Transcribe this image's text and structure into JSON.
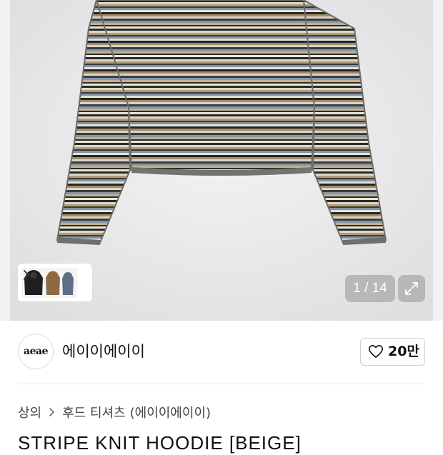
{
  "gallery": {
    "counter": "1 / 14",
    "colors": {
      "background": "#e9e9eb",
      "stripe_dark": "#2b2a26",
      "stripe_tan": "#b39b73",
      "stripe_blue": "#7f93ab",
      "stripe_cream": "#ddd8ca"
    }
  },
  "brand": {
    "logo_text": "aeae",
    "name": "에이이에이이",
    "likes": "20만"
  },
  "breadcrumb": {
    "category": "상의",
    "subcategory": "후드 티셔츠",
    "brand_suffix": "(에이이에이이)"
  },
  "product": {
    "title": "STRIPE KNIT HOODIE [BEIGE]"
  }
}
